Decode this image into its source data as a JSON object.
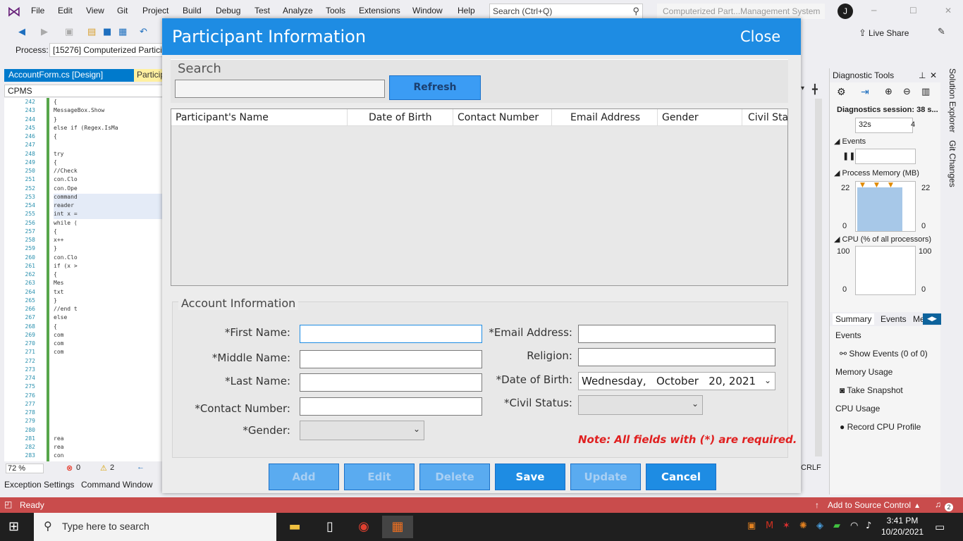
{
  "vs": {
    "menu": [
      "File",
      "Edit",
      "View",
      "Git",
      "Project",
      "Build",
      "Debug",
      "Test",
      "Analyze",
      "Tools",
      "Extensions",
      "Window",
      "Help"
    ],
    "search_placeholder": "Search (Ctrl+Q)",
    "window_title": "Computerized Part...Management System",
    "avatar_letter": "J",
    "live_share": "Live Share",
    "process_label": "Process:",
    "process_value": "[15276] Computerized Partici",
    "tab_account": "AccountForm.cs [Design]",
    "tab_participant": "Particip",
    "class_dropdown": "CPMS",
    "zoom": "72 %",
    "errors": "0",
    "warnings": "2",
    "bottom_tabs": [
      "Exception Settings",
      "Command Window"
    ],
    "status_ready": "Ready",
    "add_source_control": "Add to Source Control",
    "crlf": "CRLF",
    "notif_count": "2",
    "line_numbers": [
      "242",
      "243",
      "244",
      "245",
      "246",
      "247",
      "248",
      "249",
      "250",
      "251",
      "252",
      "253",
      "254",
      "255",
      "256",
      "257",
      "258",
      "259",
      "260",
      "261",
      "262",
      "263",
      "264",
      "265",
      "266",
      "267",
      "268",
      "269",
      "270",
      "271",
      "272",
      "273",
      "274",
      "275",
      "276",
      "277",
      "278",
      "279",
      "280",
      "281",
      "282",
      "283"
    ],
    "code_lines": [
      {
        "line": "242",
        "text": "{"
      },
      {
        "line": "243",
        "text": "    MessageBox.Show"
      },
      {
        "line": "244",
        "text": "}"
      },
      {
        "line": "245",
        "text": "else if (Regex.IsMa"
      },
      {
        "line": "246",
        "text": "{"
      },
      {
        "line": "248",
        "text": "    try"
      },
      {
        "line": "249",
        "text": "    {"
      },
      {
        "line": "250",
        "text": "        //Check"
      },
      {
        "line": "251",
        "text": "        con.Clo"
      },
      {
        "line": "252",
        "text": "        con.Ope"
      },
      {
        "line": "253",
        "text": "        command"
      },
      {
        "line": "254",
        "text": "        reader"
      },
      {
        "line": "255",
        "text": "        int x ="
      },
      {
        "line": "256",
        "text": "        while ("
      },
      {
        "line": "257",
        "text": "        {"
      },
      {
        "line": "258",
        "text": "            x++"
      },
      {
        "line": "259",
        "text": "        }"
      },
      {
        "line": "260",
        "text": "        con.Clo"
      },
      {
        "line": "261",
        "text": "        if (x >"
      },
      {
        "line": "262",
        "text": "        {"
      },
      {
        "line": "263",
        "text": "            Mes"
      },
      {
        "line": "264",
        "text": "            txt"
      },
      {
        "line": "265",
        "text": "        }"
      },
      {
        "line": "266",
        "text": "        //end t"
      },
      {
        "line": "267",
        "text": "        else"
      },
      {
        "line": "268",
        "text": "        {"
      },
      {
        "line": "269",
        "text": "            com"
      },
      {
        "line": "270",
        "text": "            com"
      },
      {
        "line": "271",
        "text": "            com"
      },
      {
        "line": "281",
        "text": "            rea"
      },
      {
        "line": "282",
        "text": "            rea"
      },
      {
        "line": "283",
        "text": "            con"
      }
    ]
  },
  "diagnostics": {
    "title": "Diagnostic Tools",
    "session": "Diagnostics session: 38 s...",
    "timeline": "32s",
    "timeline2": "4",
    "events_label": "Events",
    "memory_label": "Process Memory (MB)",
    "memory_max": "22",
    "memory_min": "0",
    "cpu_label": "CPU (% of all processors)",
    "cpu_max": "100",
    "cpu_min": "0",
    "tabs": [
      "Summary",
      "Events",
      "Me"
    ],
    "sec_events": "Events",
    "show_events": "Show Events (0 of 0)",
    "sec_memory": "Memory Usage",
    "take_snapshot": "Take Snapshot",
    "sec_cpu": "CPU Usage",
    "record_cpu": "Record CPU Profile",
    "side_tabs": [
      "Solution Explorer",
      "Git Changes"
    ]
  },
  "dialog": {
    "title": "Participant Information",
    "close": "Close",
    "search_label": "Search",
    "search_value": "",
    "refresh": "Refresh",
    "columns": [
      "Participant's Name",
      "Date of Birth",
      "Contact Number",
      "Email Address",
      "Gender",
      "Civil Sta"
    ],
    "account_legend": "Account Information",
    "labels": {
      "first_name": "*First Name:",
      "middle_name": "*Middle Name:",
      "last_name": "*Last Name:",
      "contact": "*Contact Number:",
      "gender": "*Gender:",
      "email": "*Email Address:",
      "religion": "Religion:",
      "dob": "*Date of Birth:",
      "civil": "*Civil Status:"
    },
    "values": {
      "first_name": "",
      "middle_name": "",
      "last_name": "",
      "contact": "",
      "gender": "",
      "email": "",
      "religion": "",
      "dob_day": "Wednesday,",
      "dob_month": "October",
      "dob_date": "20, 2021",
      "civil": ""
    },
    "note": "Note: All fields with (*) are required.",
    "buttons": {
      "add": "Add",
      "edit": "Edit",
      "delete": "Delete",
      "save": "Save",
      "update": "Update",
      "cancel": "Cancel"
    }
  },
  "taskbar": {
    "search_placeholder": "Type here to search",
    "time": "3:41 PM",
    "date": "10/20/2021"
  },
  "colors": {
    "dialog_header": "#1e8ce3",
    "button_enabled": "#1e8ce3",
    "button_disabled": "#5aabf0",
    "note_red": "#e02020",
    "vs_status": "#c94c4c"
  }
}
